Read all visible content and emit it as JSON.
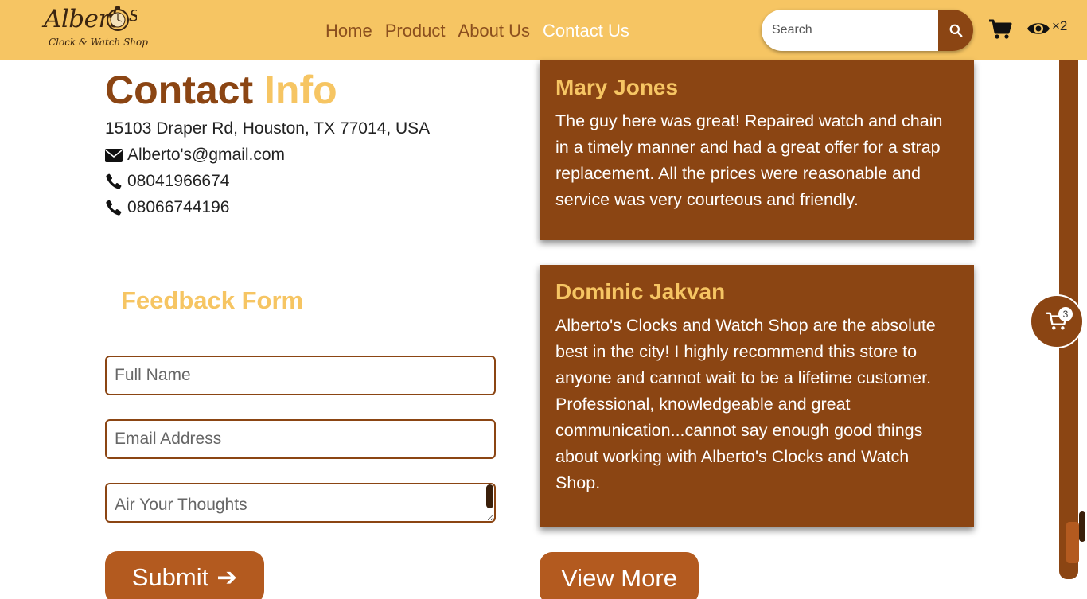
{
  "header": {
    "logo_brand": "Albert",
    "logo_brand_tail": "s",
    "logo_sub": "Clock & Watch Shop",
    "nav": [
      {
        "label": "Home",
        "active": false
      },
      {
        "label": "Product",
        "active": false
      },
      {
        "label": "About Us",
        "active": false
      },
      {
        "label": "Contact Us",
        "active": true
      }
    ],
    "search_placeholder": "Search",
    "search_icon": "search-icon",
    "cart_icon": "cart-icon",
    "eye_icon": "eye-icon",
    "eye_count": "×2"
  },
  "contact": {
    "title_main": "Contact",
    "title_accent": "Info",
    "address": "15103 Draper Rd, Houston, TX 77014, USA",
    "email": "Alberto's@gmail.com",
    "phone1": "08041966674",
    "phone2": "08066744196"
  },
  "feedback": {
    "title": "Feedback Form",
    "name_placeholder": "Full Name",
    "email_placeholder": "Email Address",
    "thoughts_placeholder": "Air Your Thoughts",
    "submit_label": "Submit",
    "submit_arrow": "➔"
  },
  "reviews": [
    {
      "name": "Mary Jones",
      "text": "The guy here was great! Repaired watch and chain in a timely manner and had a great offer for a strap replacement. All the prices were reasonable and service was very courteous and friendly."
    },
    {
      "name": "Dominic Jakvan",
      "text": "Alberto's Clocks and Watch Shop are the absolute best in the city! I highly recommend this store to anyone and cannot wait to be a lifetime customer. Professional, knowledgeable and great communication...cannot say enough good things about working with Alberto's Clocks and Watch Shop."
    }
  ],
  "view_more_label": "View More",
  "floating_cart": {
    "count": "3"
  },
  "colors": {
    "header_bg": "#f6c563",
    "brown": "#8b4513",
    "button_brown": "#b35a1f",
    "accent_yellow": "#f6c563"
  }
}
